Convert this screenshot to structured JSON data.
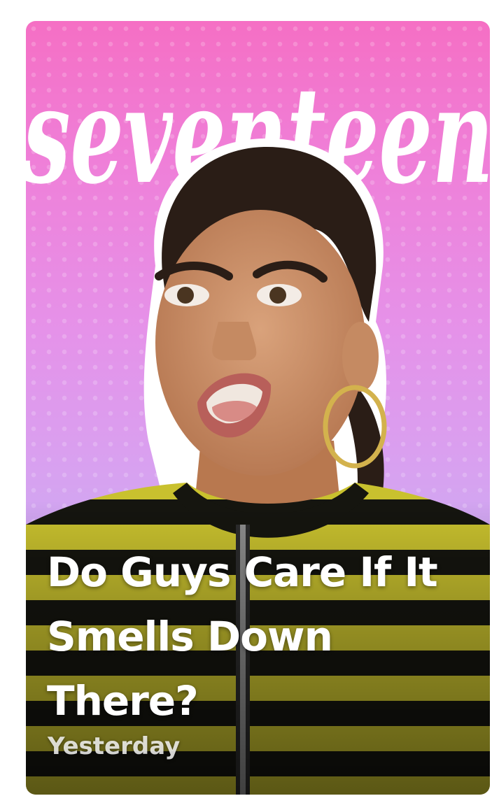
{
  "card": {
    "publisher_logo_text": "seventeen",
    "headline": "Do Guys Care If It Smells Down There?",
    "timestamp": "Yesterday"
  },
  "colors": {
    "background_top": "#f56fc4",
    "background_bottom": "#cda9f2",
    "stripe_yellow": "#c9c12e",
    "stripe_black": "#15150f",
    "text": "#ffffff"
  }
}
